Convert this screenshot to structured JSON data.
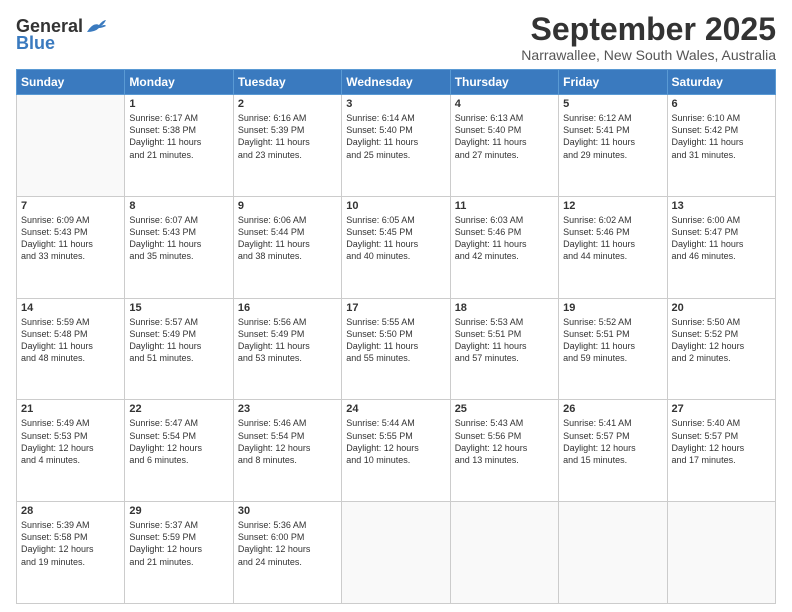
{
  "header": {
    "logo_general": "General",
    "logo_blue": "Blue",
    "month_title": "September 2025",
    "subtitle": "Narrawallee, New South Wales, Australia"
  },
  "days": [
    "Sunday",
    "Monday",
    "Tuesday",
    "Wednesday",
    "Thursday",
    "Friday",
    "Saturday"
  ],
  "weeks": [
    [
      {
        "day": "",
        "info": ""
      },
      {
        "day": "1",
        "info": "Sunrise: 6:17 AM\nSunset: 5:38 PM\nDaylight: 11 hours\nand 21 minutes."
      },
      {
        "day": "2",
        "info": "Sunrise: 6:16 AM\nSunset: 5:39 PM\nDaylight: 11 hours\nand 23 minutes."
      },
      {
        "day": "3",
        "info": "Sunrise: 6:14 AM\nSunset: 5:40 PM\nDaylight: 11 hours\nand 25 minutes."
      },
      {
        "day": "4",
        "info": "Sunrise: 6:13 AM\nSunset: 5:40 PM\nDaylight: 11 hours\nand 27 minutes."
      },
      {
        "day": "5",
        "info": "Sunrise: 6:12 AM\nSunset: 5:41 PM\nDaylight: 11 hours\nand 29 minutes."
      },
      {
        "day": "6",
        "info": "Sunrise: 6:10 AM\nSunset: 5:42 PM\nDaylight: 11 hours\nand 31 minutes."
      }
    ],
    [
      {
        "day": "7",
        "info": "Sunrise: 6:09 AM\nSunset: 5:43 PM\nDaylight: 11 hours\nand 33 minutes."
      },
      {
        "day": "8",
        "info": "Sunrise: 6:07 AM\nSunset: 5:43 PM\nDaylight: 11 hours\nand 35 minutes."
      },
      {
        "day": "9",
        "info": "Sunrise: 6:06 AM\nSunset: 5:44 PM\nDaylight: 11 hours\nand 38 minutes."
      },
      {
        "day": "10",
        "info": "Sunrise: 6:05 AM\nSunset: 5:45 PM\nDaylight: 11 hours\nand 40 minutes."
      },
      {
        "day": "11",
        "info": "Sunrise: 6:03 AM\nSunset: 5:46 PM\nDaylight: 11 hours\nand 42 minutes."
      },
      {
        "day": "12",
        "info": "Sunrise: 6:02 AM\nSunset: 5:46 PM\nDaylight: 11 hours\nand 44 minutes."
      },
      {
        "day": "13",
        "info": "Sunrise: 6:00 AM\nSunset: 5:47 PM\nDaylight: 11 hours\nand 46 minutes."
      }
    ],
    [
      {
        "day": "14",
        "info": "Sunrise: 5:59 AM\nSunset: 5:48 PM\nDaylight: 11 hours\nand 48 minutes."
      },
      {
        "day": "15",
        "info": "Sunrise: 5:57 AM\nSunset: 5:49 PM\nDaylight: 11 hours\nand 51 minutes."
      },
      {
        "day": "16",
        "info": "Sunrise: 5:56 AM\nSunset: 5:49 PM\nDaylight: 11 hours\nand 53 minutes."
      },
      {
        "day": "17",
        "info": "Sunrise: 5:55 AM\nSunset: 5:50 PM\nDaylight: 11 hours\nand 55 minutes."
      },
      {
        "day": "18",
        "info": "Sunrise: 5:53 AM\nSunset: 5:51 PM\nDaylight: 11 hours\nand 57 minutes."
      },
      {
        "day": "19",
        "info": "Sunrise: 5:52 AM\nSunset: 5:51 PM\nDaylight: 11 hours\nand 59 minutes."
      },
      {
        "day": "20",
        "info": "Sunrise: 5:50 AM\nSunset: 5:52 PM\nDaylight: 12 hours\nand 2 minutes."
      }
    ],
    [
      {
        "day": "21",
        "info": "Sunrise: 5:49 AM\nSunset: 5:53 PM\nDaylight: 12 hours\nand 4 minutes."
      },
      {
        "day": "22",
        "info": "Sunrise: 5:47 AM\nSunset: 5:54 PM\nDaylight: 12 hours\nand 6 minutes."
      },
      {
        "day": "23",
        "info": "Sunrise: 5:46 AM\nSunset: 5:54 PM\nDaylight: 12 hours\nand 8 minutes."
      },
      {
        "day": "24",
        "info": "Sunrise: 5:44 AM\nSunset: 5:55 PM\nDaylight: 12 hours\nand 10 minutes."
      },
      {
        "day": "25",
        "info": "Sunrise: 5:43 AM\nSunset: 5:56 PM\nDaylight: 12 hours\nand 13 minutes."
      },
      {
        "day": "26",
        "info": "Sunrise: 5:41 AM\nSunset: 5:57 PM\nDaylight: 12 hours\nand 15 minutes."
      },
      {
        "day": "27",
        "info": "Sunrise: 5:40 AM\nSunset: 5:57 PM\nDaylight: 12 hours\nand 17 minutes."
      }
    ],
    [
      {
        "day": "28",
        "info": "Sunrise: 5:39 AM\nSunset: 5:58 PM\nDaylight: 12 hours\nand 19 minutes."
      },
      {
        "day": "29",
        "info": "Sunrise: 5:37 AM\nSunset: 5:59 PM\nDaylight: 12 hours\nand 21 minutes."
      },
      {
        "day": "30",
        "info": "Sunrise: 5:36 AM\nSunset: 6:00 PM\nDaylight: 12 hours\nand 24 minutes."
      },
      {
        "day": "",
        "info": ""
      },
      {
        "day": "",
        "info": ""
      },
      {
        "day": "",
        "info": ""
      },
      {
        "day": "",
        "info": ""
      }
    ]
  ]
}
